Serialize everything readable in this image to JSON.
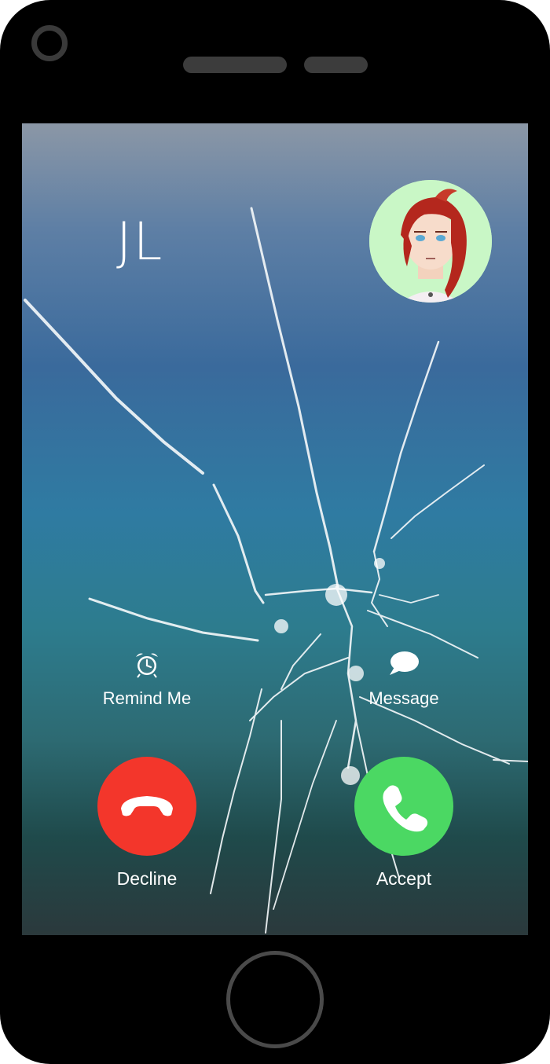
{
  "call": {
    "caller_name": "JL",
    "avatar_icon": "caller-avatar-portrait"
  },
  "actions": {
    "remind_me": {
      "label": "Remind Me",
      "icon": "alarm-clock-icon"
    },
    "message": {
      "label": "Message",
      "icon": "speech-bubble-icon"
    }
  },
  "buttons": {
    "decline": {
      "label": "Decline",
      "icon": "phone-hangup-icon",
      "color": "#f3362b"
    },
    "accept": {
      "label": "Accept",
      "icon": "phone-icon",
      "color": "#4bd863"
    }
  },
  "screen": {
    "state": "cracked",
    "text_color": "#ffffff"
  }
}
